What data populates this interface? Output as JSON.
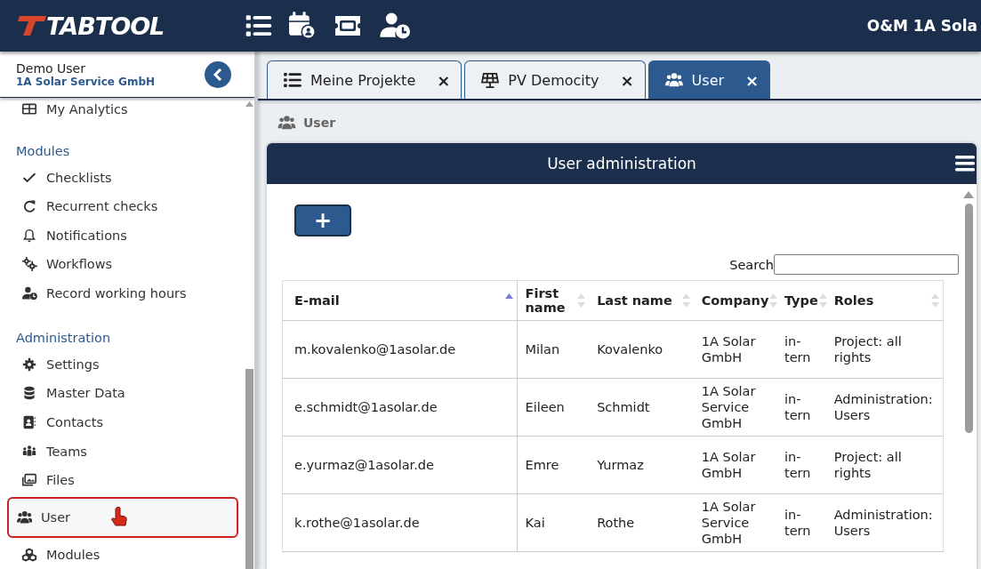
{
  "topbar": {
    "logo": "TABTOOL",
    "tenant": "O&M 1A Sola"
  },
  "user": {
    "name": "Demo User",
    "company": "1A Solar Service GmbH"
  },
  "sidebar": {
    "sections": [
      {
        "items": [
          {
            "label": "My Analytics",
            "selected": false
          }
        ]
      },
      {
        "title": "Modules",
        "items": [
          {
            "label": "Checklists",
            "selected": false
          },
          {
            "label": "Recurrent checks",
            "selected": false
          },
          {
            "label": "Notifications",
            "selected": false
          },
          {
            "label": "Workflows",
            "selected": false
          },
          {
            "label": "Record working hours",
            "selected": false
          }
        ]
      },
      {
        "title": "Administration",
        "items": [
          {
            "label": "Settings",
            "selected": false
          },
          {
            "label": "Master Data",
            "selected": false
          },
          {
            "label": "Contacts",
            "selected": false
          },
          {
            "label": "Teams",
            "selected": false
          },
          {
            "label": "Files",
            "selected": false
          },
          {
            "label": "User",
            "selected": true
          },
          {
            "label": "Modules",
            "selected": false
          }
        ]
      }
    ]
  },
  "tabs": [
    {
      "label": "Meine Projekte",
      "selected": false,
      "close": "×"
    },
    {
      "label": "PV Democity",
      "selected": false,
      "close": "×"
    },
    {
      "label": "User",
      "selected": true,
      "close": "×"
    }
  ],
  "breadcrumb": "User",
  "panel": {
    "title": "User administration",
    "add_button": "+",
    "search": {
      "label": "Search"
    },
    "table": {
      "columns": [
        {
          "label": "E-mail",
          "sorted": true
        },
        {
          "label": "First name",
          "sorted": false
        },
        {
          "label": "Last name",
          "sorted": false
        },
        {
          "label": "Company",
          "sorted": false
        },
        {
          "label": "Type",
          "sorted": false
        },
        {
          "label": "Roles",
          "sorted": false
        }
      ],
      "rows": [
        [
          "m.kovalenko@1asolar.de",
          "Milan",
          "Kovalenko",
          "1A Solar GmbH",
          "in-tern",
          "Project: all rights"
        ],
        [
          "e.schmidt@1asolar.de",
          "Eileen",
          "Schmidt",
          "1A Solar Service GmbH",
          "in-tern",
          "Administration: Users"
        ],
        [
          "e.yurmaz@1asolar.de",
          "Emre",
          "Yurmaz",
          "1A Solar GmbH",
          "in-tern",
          "Project: all rights"
        ],
        [
          "k.rothe@1asolar.de",
          "Kai",
          "Rothe",
          "1A Solar Service GmbH",
          "in-tern",
          "Administration: Users"
        ]
      ]
    }
  }
}
